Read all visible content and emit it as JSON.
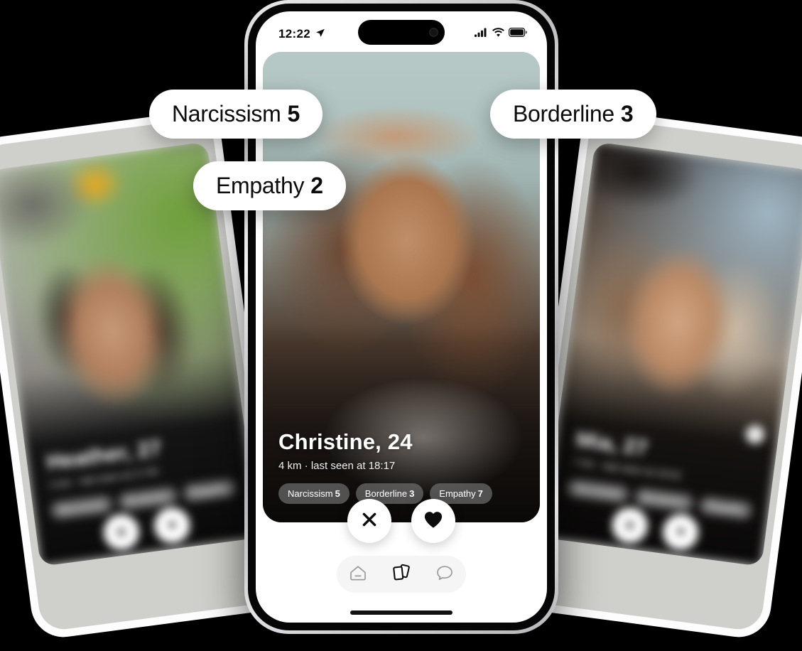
{
  "statusbar": {
    "time": "12:22",
    "location_icon": "location-arrow-icon",
    "cellular_icon": "cellular-bars-icon",
    "wifi_icon": "wifi-icon",
    "battery_icon": "battery-icon"
  },
  "floating_pills": [
    {
      "label": "Narcissism",
      "value": "5"
    },
    {
      "label": "Empathy",
      "value": "2"
    },
    {
      "label": "Borderline",
      "value": "3"
    }
  ],
  "card": {
    "name": "Christine, 24",
    "meta": "4 km · last seen at 18:17",
    "tags": [
      {
        "label": "Narcissism",
        "value": "5"
      },
      {
        "label": "Borderline",
        "value": "3"
      },
      {
        "label": "Empathy",
        "value": "7"
      }
    ]
  },
  "actions": {
    "pass_icon": "close-x-icon",
    "pass_label": "✕",
    "like_icon": "heart-icon"
  },
  "nav": [
    {
      "icon": "home-icon",
      "active": false
    },
    {
      "icon": "cards-stack-icon",
      "active": true
    },
    {
      "icon": "chat-bubble-icon",
      "active": false
    }
  ],
  "side_phones": {
    "left": {
      "name": "Heather, 27",
      "meta": "2 km · last seen at 17:40",
      "tags": [
        {
          "label": "Narcissism",
          "value": "6"
        },
        {
          "label": "Borderline",
          "value": "4"
        },
        {
          "label": "Empathy",
          "value": "5"
        }
      ],
      "pass_label": "✕",
      "like_label": "♥"
    },
    "right": {
      "name": "Mia, 27",
      "meta": "7 km · last seen at 19:02",
      "tags": [
        {
          "label": "Narcissism",
          "value": "4"
        },
        {
          "label": "Borderline",
          "value": "5"
        },
        {
          "label": "Empathy",
          "value": "6"
        }
      ],
      "pass_label": "✕",
      "like_label": "♥"
    }
  },
  "colors": {
    "background": "#000000",
    "pill_bg": "#ffffff",
    "pill_text": "#0c0c0c",
    "screen_bg": "#ffffff",
    "tag_bg": "rgba(115,115,115,0.68)",
    "nav_bg": "#f5f5f5",
    "accent_dark": "#111111"
  }
}
